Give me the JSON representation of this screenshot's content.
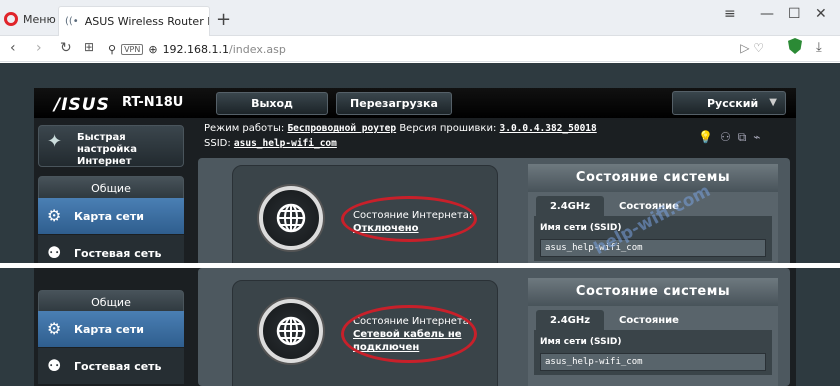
{
  "browser": {
    "menu_label": "Меню",
    "tab_title": "ASUS Wireless Router RT-N",
    "url_host": "192.168.1.1",
    "url_path": "/index.asp",
    "vpn_badge": "VPN",
    "accent": "#e0242a"
  },
  "router": {
    "brand": "/ISUS",
    "model": "RT-N18U",
    "logout_label": "Выход",
    "reboot_label": "Перезагрузка",
    "language_label": "Русский",
    "quick_setup_line1": "Быстрая настройка",
    "quick_setup_line2": "Интернет",
    "general_label": "Общие",
    "menu_network_map": "Карта сети",
    "menu_guest_network": "Гостевая сеть",
    "mode_label": "Режим работы:",
    "mode_value": "Беспроводной роутер",
    "firmware_label": "Версия прошивки:",
    "firmware_value": "3.0.0.4.382_50018",
    "ssid_label": "SSID:",
    "ssid_value": "asus_help-wifi_com",
    "internet_status_label": "Состояние Интернета:",
    "status_top": "Отключено",
    "status_bottom_line1": "Сетевой кабель не",
    "status_bottom_line2": "подключен",
    "system_status_title": "Состояние системы",
    "tab_band": "2.4GHz",
    "tab_status": "Состояние",
    "network_name_label": "Имя сети (SSID)",
    "network_name_value": "asus_help-wifi_com",
    "highlight_color": "#c8202a",
    "active_menu_color": "#4a7fb4"
  },
  "watermark": "help-wifi.com"
}
